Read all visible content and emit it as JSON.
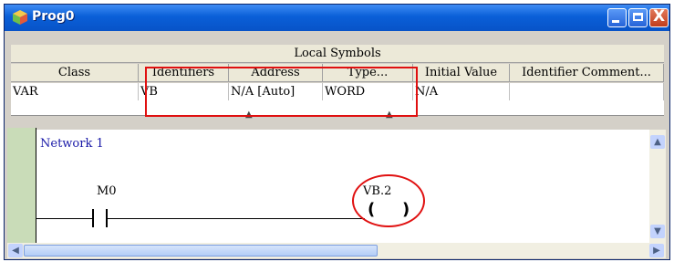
{
  "window": {
    "title": "Prog0",
    "app_icon": "program-icon",
    "buttons": {
      "minimize_icon": "minimize-icon",
      "maximize_icon": "maximize-icon",
      "close_icon": "close-icon",
      "close_glyph": "X"
    }
  },
  "local_symbols": {
    "caption": "Local Symbols",
    "columns": [
      "Class",
      "Identifiers",
      "Address",
      "Type...",
      "Initial Value",
      "Identifier Comment..."
    ],
    "rows": [
      [
        "VAR",
        "VB",
        "N/A [Auto]",
        "WORD",
        "N/A",
        ""
      ]
    ]
  },
  "ladder": {
    "network_label": "Network 1",
    "contact_label": "M0",
    "coil_label": "VB.2",
    "coil_left": "(",
    "coil_right": ")"
  },
  "colors": {
    "highlight": "#e01010",
    "titlebar": "#0a5fd8",
    "rail": "#c9dcb8",
    "network_label": "#1a1aa8"
  }
}
